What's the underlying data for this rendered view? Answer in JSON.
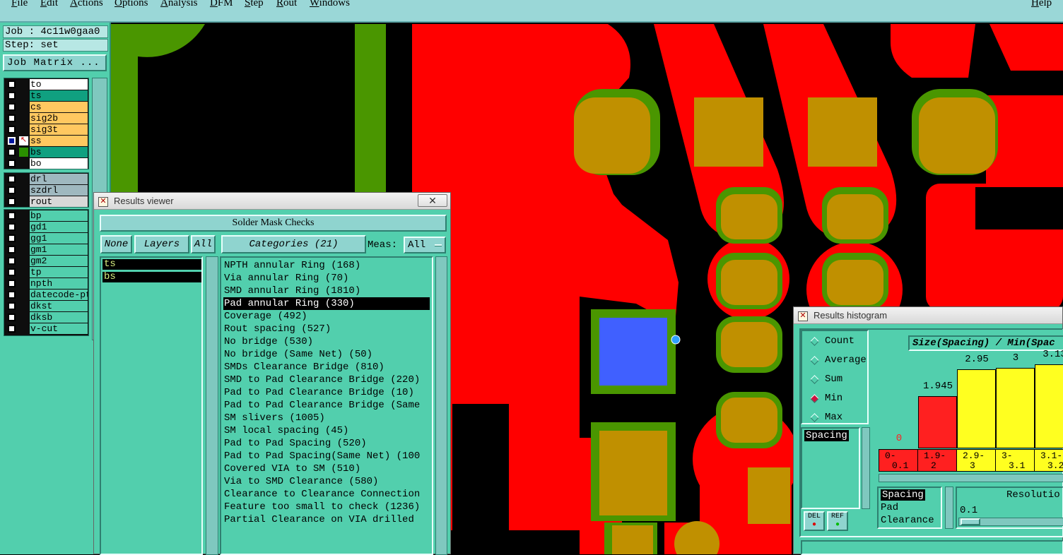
{
  "menubar": {
    "items": [
      "File",
      "Edit",
      "Actions",
      "Options",
      "Analysis",
      "DFM",
      "Step",
      "Rout",
      "Windows"
    ],
    "help": "Help"
  },
  "sidebar": {
    "job": "Job : 4c11w0gaa0",
    "step": "Step: set",
    "job_matrix_button": "Job Matrix ...",
    "layers_group1": [
      {
        "name": "to",
        "color": "#ffffff"
      },
      {
        "name": "ts",
        "color": "#10a080"
      },
      {
        "name": "cs",
        "color": "#ffc860"
      },
      {
        "name": "sig2b",
        "color": "#ffc860"
      },
      {
        "name": "sig3t",
        "color": "#ffc860"
      },
      {
        "name": "ss",
        "color": "#ffc860"
      },
      {
        "name": "bs",
        "color": "#10a080"
      },
      {
        "name": "bo",
        "color": "#ffffff"
      }
    ],
    "layers_group2": [
      {
        "name": "drl",
        "color": "#9fb8bf"
      },
      {
        "name": "szdrl",
        "color": "#9fb8bf"
      },
      {
        "name": "rout",
        "color": "#d8d8d8"
      }
    ],
    "layers_group3": [
      {
        "name": "bp",
        "color": "#52cfad"
      },
      {
        "name": "gd1",
        "color": "#52cfad"
      },
      {
        "name": "gg1",
        "color": "#52cfad"
      },
      {
        "name": "gm1",
        "color": "#52cfad"
      },
      {
        "name": "gm2",
        "color": "#52cfad"
      },
      {
        "name": "tp",
        "color": "#52cfad"
      },
      {
        "name": "npth",
        "color": "#52cfad"
      },
      {
        "name": "datecode-ptc",
        "color": "#52cfad"
      },
      {
        "name": "dkst",
        "color": "#52cfad"
      },
      {
        "name": "dksb",
        "color": "#52cfad"
      },
      {
        "name": "v-cut",
        "color": "#52cfad"
      }
    ]
  },
  "results_viewer": {
    "title": "Results viewer",
    "close": "✕",
    "header": "Solder Mask Checks",
    "none_btn": "None",
    "layers_btn": "Layers",
    "all_btn": "All",
    "categories_btn": "Categories (21)",
    "meas_label": "Meas:",
    "meas_value": "All",
    "layers": [
      "ts",
      "bs"
    ],
    "categories": [
      "NPTH annular Ring (168)",
      "Via annular Ring (70)",
      "SMD annular Ring (1810)",
      "Pad annular Ring (330)",
      "Coverage (492)",
      "Rout spacing (527)",
      "No bridge (530)",
      "No bridge (Same Net) (50)",
      "SMDs Clearance Bridge (810)",
      "SMD to Pad Clearance Bridge (220)",
      "Pad to Pad Clearance Bridge (10)",
      "Pad to Pad Clearance Bridge (Same",
      "SM slivers (1005)",
      "SM local spacing (45)",
      "Pad to Pad Spacing (520)",
      "Pad to Pad Spacing(Same Net) (100",
      "Covered VIA to SM (510)",
      "Via to SMD Clearance (580)",
      "Clearance to Clearance Connection",
      "Feature too small to check (1236)",
      "Partial Clearance on VIA drilled"
    ],
    "selected_category": "Pad annular Ring (330)"
  },
  "results_histogram": {
    "title": "Results histogram",
    "modes": [
      "Count",
      "Average",
      "Sum",
      "Min",
      "Max"
    ],
    "selected_mode": "Min",
    "measure_list": [
      "Spacing"
    ],
    "del_btn": "DEL",
    "ref_btn": "REF",
    "chart_title": "Size(Spacing) / Min(Spac",
    "resolution_label": "Resolutio",
    "resolution_value": "0.1",
    "meas_list": [
      "Spacing",
      "Pad",
      "Clearance"
    ]
  },
  "chart_data": {
    "type": "bar",
    "title": "Size(Spacing) / Min(Spac",
    "categories": [
      "0-0.1",
      "1.9-2",
      "2.9-3",
      "3-3.1",
      "3.1-3.2"
    ],
    "values": [
      0,
      1.945,
      2.95,
      3,
      3.13
    ],
    "value_labels": [
      "0",
      "1.945",
      "2.95",
      "3",
      "3.13"
    ],
    "colors": [
      "#ffff20",
      "#ff2020",
      "#ffff20",
      "#ffff20",
      "#ffff20"
    ],
    "range_labels": [
      [
        "0-",
        "0.1"
      ],
      [
        "1.9-",
        "2"
      ],
      [
        "2.9-",
        "3"
      ],
      [
        "3-",
        "3.1"
      ],
      [
        "3.1-",
        "3.2"
      ]
    ],
    "grid": false
  },
  "colors": {
    "panel": "#52cfad",
    "menubar": "#9ad7d7",
    "copper": "#ff0000",
    "mask": "#4a9600",
    "pad": "#c09000",
    "selected": "#4060ff"
  }
}
